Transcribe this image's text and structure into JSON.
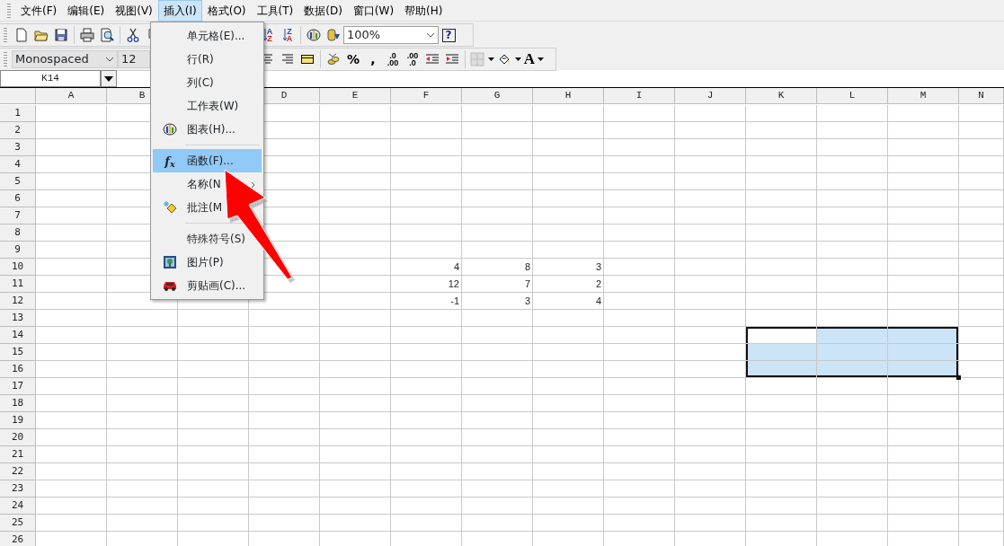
{
  "menubar": [
    {
      "label": "文件(F)",
      "selected": false
    },
    {
      "label": "编辑(E)",
      "selected": false
    },
    {
      "label": "视图(V)",
      "selected": false
    },
    {
      "label": "插入(I)",
      "selected": true
    },
    {
      "label": "格式(O)",
      "selected": false
    },
    {
      "label": "工具(T)",
      "selected": false
    },
    {
      "label": "数据(D)",
      "selected": false
    },
    {
      "label": "窗口(W)",
      "selected": false
    },
    {
      "label": "帮助(H)",
      "selected": false
    }
  ],
  "standard_toolbar": {
    "left": [
      {
        "kind": "new"
      },
      {
        "kind": "open"
      },
      {
        "kind": "save"
      },
      {
        "kind": "separator"
      },
      {
        "kind": "print"
      },
      {
        "kind": "preview"
      },
      {
        "kind": "separator"
      },
      {
        "kind": "cut"
      },
      {
        "kind": "copy"
      }
    ],
    "right": [
      {
        "kind": "sort",
        "top": "A",
        "bottom": "Z"
      },
      {
        "kind": "sort",
        "top": "Z",
        "bottom": "A"
      },
      {
        "kind": "separator"
      },
      {
        "kind": "chart"
      },
      {
        "kind": "pivot"
      },
      {
        "kind": "combo",
        "value": "100%"
      },
      {
        "kind": "help",
        "glyph": "?"
      }
    ]
  },
  "format_toolbar": {
    "left": [
      {
        "kind": "combo",
        "value": "Monospaced"
      },
      {
        "kind": "combo",
        "value": "12"
      }
    ],
    "right": [
      {
        "kind": "align-center"
      },
      {
        "kind": "align-right"
      },
      {
        "kind": "merge"
      },
      {
        "kind": "separator"
      },
      {
        "kind": "currency"
      },
      {
        "kind": "glyph",
        "glyph": "%"
      },
      {
        "kind": "glyph",
        "glyph": ","
      },
      {
        "kind": "decimal",
        "top": ".0",
        "bottom": ".00"
      },
      {
        "kind": "decimal",
        "top": ".00",
        "bottom": ".0"
      },
      {
        "kind": "outdent"
      },
      {
        "kind": "indent"
      },
      {
        "kind": "separator"
      },
      {
        "kind": "borders"
      },
      {
        "kind": "fill"
      },
      {
        "kind": "font-color",
        "glyph": "A"
      }
    ]
  },
  "name_box": "K14",
  "insert_menu": [
    {
      "kind": "item",
      "label": "单元格(E)...",
      "selected": false
    },
    {
      "kind": "item",
      "label": "行(R)",
      "selected": false
    },
    {
      "kind": "item",
      "label": "列(C)",
      "selected": false
    },
    {
      "kind": "item",
      "label": "工作表(W)",
      "selected": false
    },
    {
      "kind": "item",
      "label": "图表(H)...",
      "selected": false
    },
    {
      "kind": "separator"
    },
    {
      "kind": "item",
      "label": "函数(F)...",
      "selected": true,
      "icon_text": "f$_{x}$"
    },
    {
      "kind": "item",
      "label": "名称(N",
      "selected": false,
      "has_submenu": true
    },
    {
      "kind": "item",
      "label": "批注(M",
      "selected": false
    },
    {
      "kind": "separator"
    },
    {
      "kind": "item",
      "label": "特殊符号(S)",
      "selected": false
    },
    {
      "kind": "item",
      "label": "图片(P)",
      "selected": false
    },
    {
      "kind": "item",
      "label": "剪贴画(C)...",
      "selected": false
    }
  ],
  "sheet": {
    "columns": [
      {
        "label": "A"
      },
      {
        "label": "B"
      },
      {},
      {
        "label": "D"
      },
      {
        "label": "E"
      },
      {
        "label": "F"
      },
      {
        "label": "G"
      },
      {
        "label": "H"
      },
      {
        "label": "I"
      },
      {
        "label": "J"
      },
      {
        "label": "K"
      },
      {
        "label": "L"
      },
      {
        "label": "M"
      },
      {
        "label": "N"
      }
    ],
    "rows": [
      {
        "header": "1"
      },
      {
        "header": "2"
      },
      {
        "header": "3"
      },
      {
        "header": "4"
      },
      {
        "header": "5"
      },
      {
        "header": "6"
      },
      {
        "header": "7"
      },
      {
        "header": "8"
      },
      {
        "header": "9"
      },
      {
        "header": "10",
        "cells": [
          {
            "selected": false
          },
          {
            "selected": false
          },
          {},
          {
            "selected": false
          },
          {
            "selected": false
          },
          {
            "text": "4",
            "selected": false
          },
          {
            "text": "8",
            "selected": false
          },
          {
            "text": "3",
            "selected": false
          }
        ]
      },
      {
        "header": "11",
        "cells": [
          {
            "selected": false
          },
          {
            "selected": false
          },
          {},
          {
            "selected": false
          },
          {
            "selected": false
          },
          {
            "text": "12",
            "selected": false
          },
          {
            "text": "7",
            "selected": false
          },
          {
            "text": "2",
            "selected": false
          }
        ]
      },
      {
        "header": "12",
        "cells": [
          {
            "selected": false
          },
          {
            "selected": false
          },
          {},
          {
            "selected": false
          },
          {
            "selected": false
          },
          {
            "text": "-1",
            "selected": false
          },
          {
            "text": "3",
            "selected": false
          },
          {
            "text": "4",
            "selected": false
          }
        ]
      },
      {
        "header": "13"
      },
      {
        "header": "14",
        "cells": [
          {
            "selected": false
          },
          {
            "selected": false
          },
          {
            "selected": false
          },
          {
            "selected": false
          },
          {
            "selected": false
          },
          {
            "selected": false
          },
          {
            "selected": false
          },
          {
            "selected": false
          },
          {
            "selected": false
          },
          {
            "selected": false
          },
          {
            "selected": true,
            "active": true
          },
          {
            "selected": true
          },
          {
            "selected": true
          }
        ]
      },
      {
        "header": "15",
        "cells": [
          {
            "selected": false
          },
          {
            "selected": false
          },
          {
            "selected": false
          },
          {
            "selected": false
          },
          {
            "selected": false
          },
          {
            "selected": false
          },
          {
            "selected": false
          },
          {
            "selected": false
          },
          {
            "selected": false
          },
          {
            "selected": false
          },
          {
            "selected": true
          },
          {
            "selected": true
          },
          {
            "selected": true
          }
        ]
      },
      {
        "header": "16",
        "cells": [
          {
            "selected": false
          },
          {
            "selected": false
          },
          {
            "selected": false
          },
          {
            "selected": false
          },
          {
            "selected": false
          },
          {
            "selected": false
          },
          {
            "selected": false
          },
          {
            "selected": false
          },
          {
            "selected": false
          },
          {
            "selected": false
          },
          {
            "selected": true
          },
          {
            "selected": true
          },
          {
            "selected": true
          }
        ]
      },
      {
        "header": "17"
      },
      {
        "header": "18"
      },
      {
        "header": "19"
      },
      {
        "header": "20"
      },
      {
        "header": "21"
      },
      {
        "header": "22"
      },
      {
        "header": "23"
      },
      {
        "header": "24"
      },
      {
        "header": "25"
      },
      {
        "header": "26"
      }
    ]
  }
}
